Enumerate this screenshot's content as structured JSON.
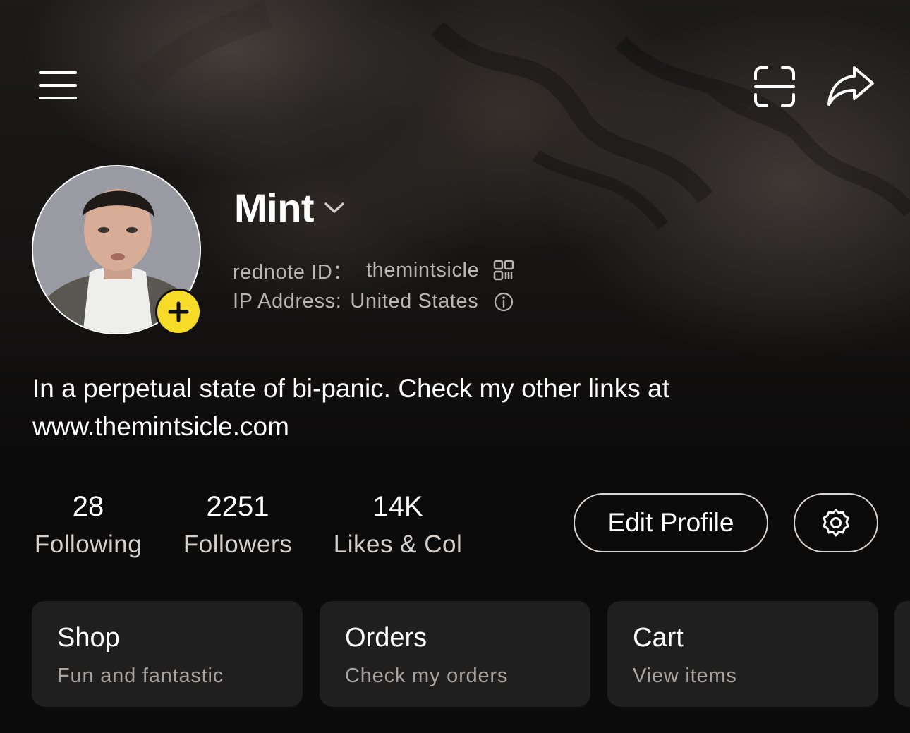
{
  "header": {
    "menu_icon": "hamburger-menu-icon",
    "scan_icon": "scan-icon",
    "share_icon": "share-arrow-icon"
  },
  "profile": {
    "name": "Mint",
    "id_label": "rednote ID：",
    "id_value": "themintsicle",
    "ip_label": "IP Address:",
    "ip_value": "United States",
    "bio": "In a perpetual state of bi-panic. Check my other links at www.themintsicle.com"
  },
  "stats": [
    {
      "value": "28",
      "label": "Following"
    },
    {
      "value": "2251",
      "label": "Followers"
    },
    {
      "value": "14K",
      "label": "Likes & Col"
    }
  ],
  "actions": {
    "edit_profile": "Edit Profile",
    "settings_icon": "gear-icon"
  },
  "cards": [
    {
      "title": "Shop",
      "subtitle": "Fun and fantastic"
    },
    {
      "title": "Orders",
      "subtitle": "Check my orders"
    },
    {
      "title": "Cart",
      "subtitle": "View items"
    }
  ],
  "colors": {
    "accent_yellow": "#f6dc28",
    "background": "#0c0b0b",
    "card": "#201f1f"
  }
}
